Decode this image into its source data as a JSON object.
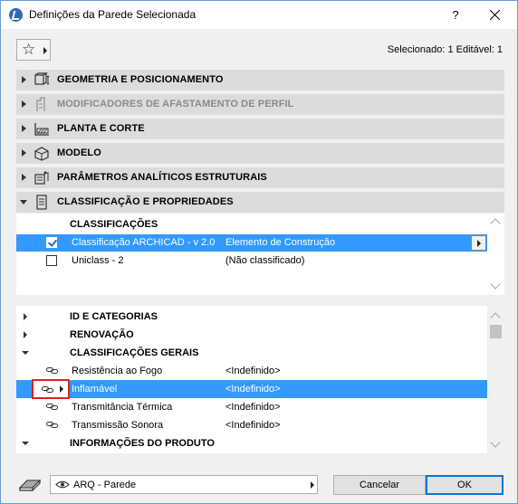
{
  "window": {
    "title": "Definições da Parede Selecionada",
    "help_label": "?"
  },
  "toolbar": {
    "favorites_icon": "star-icon",
    "selected_info": "Selecionado: 1 Editável: 1"
  },
  "panels": [
    {
      "label": "GEOMETRIA E POSICIONAMENTO",
      "icon": "geometry-icon",
      "expanded": false,
      "disabled": false
    },
    {
      "label": "MODIFICADORES DE AFASTAMENTO DE PERFIL",
      "icon": "profile-offset-icon",
      "expanded": false,
      "disabled": true
    },
    {
      "label": "PLANTA E CORTE",
      "icon": "floorplan-section-icon",
      "expanded": false,
      "disabled": false
    },
    {
      "label": "MODELO",
      "icon": "model-icon",
      "expanded": false,
      "disabled": false
    },
    {
      "label": "PARÂMETROS ANALÍTICOS ESTRUTURAIS",
      "icon": "structural-analytics-icon",
      "expanded": false,
      "disabled": false
    },
    {
      "label": "CLASSIFICAÇÃO E PROPRIEDADES",
      "icon": "classification-icon",
      "expanded": true,
      "disabled": false
    }
  ],
  "classifications": {
    "header": "CLASSIFICAÇÕES",
    "rows": [
      {
        "name": "Classificação ARCHICAD - v 2.0",
        "value": "Elemento de Construção",
        "checked": true,
        "selected": true
      },
      {
        "name": "Uniclass - 2",
        "value": "(Não classificado)",
        "checked": false,
        "selected": false
      }
    ]
  },
  "properties": {
    "rows": [
      {
        "kind": "group",
        "label": "ID E CATEGORIAS",
        "expanded": false
      },
      {
        "kind": "group",
        "label": "RENOVAÇÃO",
        "expanded": false
      },
      {
        "kind": "group",
        "label": "CLASSIFICAÇÕES GERAIS",
        "expanded": true
      },
      {
        "kind": "item",
        "label": "Resistência ao Fogo",
        "value": "<Indefinido>",
        "selected": false
      },
      {
        "kind": "item",
        "label": "Inflamável",
        "value": "<Indefinido>",
        "selected": true
      },
      {
        "kind": "item",
        "label": "Transmitância Térmica",
        "value": "<Indefinido>",
        "selected": false
      },
      {
        "kind": "item",
        "label": "Transmissão Sonora",
        "value": "<Indefinido>",
        "selected": false
      },
      {
        "kind": "group",
        "label": "INFORMAÇÕES DO PRODUTO",
        "expanded": true
      }
    ]
  },
  "footer": {
    "view_label": "ARQ - Parede",
    "cancel_label": "Cancelar",
    "ok_label": "OK"
  },
  "colors": {
    "selection": "#3399ff",
    "panel_header": "#dcdcdc",
    "highlight_border": "#e0201f"
  }
}
